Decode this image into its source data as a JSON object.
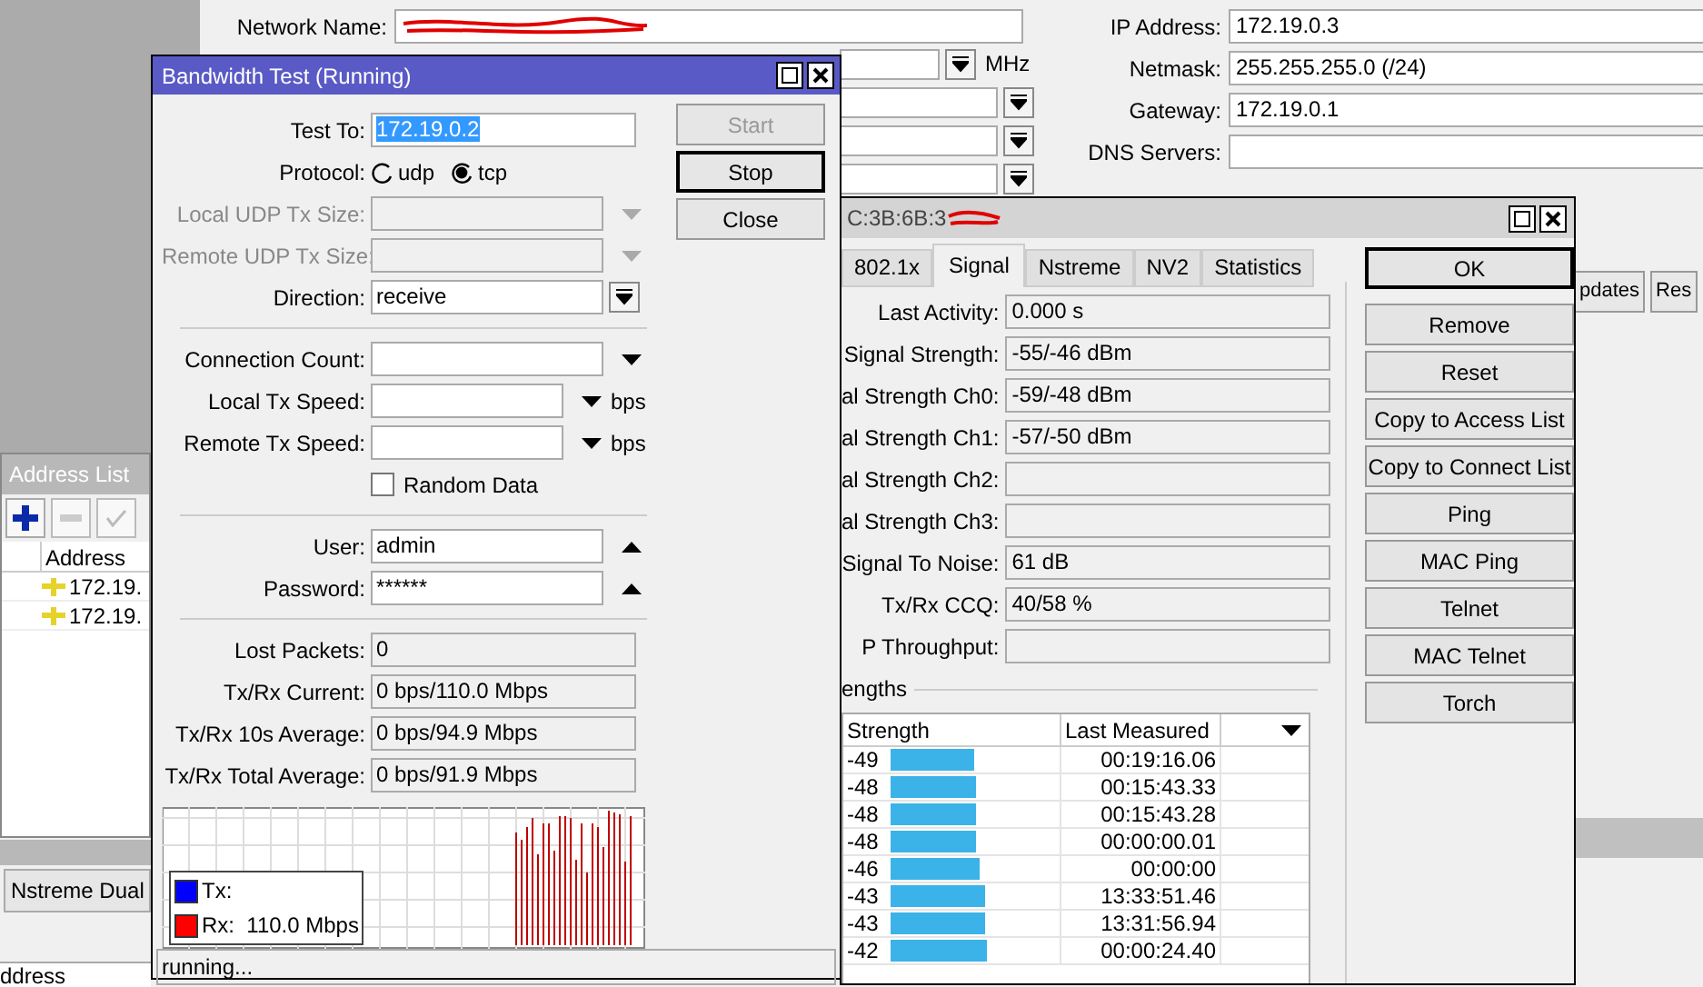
{
  "main_window": {
    "network_name": {
      "label": "Network Name:"
    },
    "frequency_unit": "MHz",
    "right_fields": [
      {
        "label": "IP Address:",
        "value": "172.19.0.3"
      },
      {
        "label": "Netmask:",
        "value": "255.255.255.0 (/24)"
      },
      {
        "label": "Gateway:",
        "value": "172.19.0.1"
      },
      {
        "label": "DNS Servers:"
      }
    ],
    "buttons": [
      "pdates",
      "Res"
    ]
  },
  "address_list": {
    "title": "Address List",
    "columns": [
      "Address"
    ],
    "rows": [
      "172.19.",
      "172.19."
    ]
  },
  "bottom_tab": "Nstreme Dual",
  "bottom_table": {
    "columns": [
      "ddress"
    ]
  },
  "bandwidth_test": {
    "title": "Bandwidth Test (Running)",
    "fields": [
      {
        "kind": "text",
        "label": "Test To:",
        "value": "172.19.0.2",
        "highlighted": true
      },
      {
        "kind": "radio",
        "label": "Protocol:",
        "options": [
          {
            "label": "udp",
            "selected": false
          },
          {
            "label": "tcp",
            "selected": true
          }
        ]
      },
      {
        "kind": "dropdown",
        "label": "Local UDP Tx Size:",
        "disabled": true
      },
      {
        "kind": "dropdown",
        "label": "Remote UDP Tx Size:",
        "disabled": true
      },
      {
        "kind": "select",
        "label": "Direction:",
        "value": "receive"
      },
      {
        "kind": "separator"
      },
      {
        "kind": "dropdown",
        "label": "Connection Count:",
        "disabled": false
      },
      {
        "kind": "dropdown",
        "label": "Local Tx Speed:",
        "disabled": false,
        "unit": "bps"
      },
      {
        "kind": "dropdown",
        "label": "Remote Tx Speed:",
        "disabled": false,
        "unit": "bps"
      },
      {
        "kind": "checkbox",
        "label": "Random Data",
        "checked": false
      },
      {
        "kind": "separator"
      },
      {
        "kind": "collapse",
        "label": "User:",
        "value": "admin"
      },
      {
        "kind": "collapse",
        "label": "Password:",
        "value": "******"
      },
      {
        "kind": "separator"
      },
      {
        "kind": "readonly",
        "label": "Lost Packets:",
        "value": "0"
      },
      {
        "kind": "readonly",
        "label": "Tx/Rx Current:",
        "value": "0 bps/110.0 Mbps"
      },
      {
        "kind": "readonly",
        "label": "Tx/Rx 10s Average:",
        "value": "0 bps/94.9 Mbps"
      },
      {
        "kind": "readonly",
        "label": "Tx/Rx Total Average:",
        "value": "0 bps/91.9 Mbps"
      }
    ],
    "buttons": [
      {
        "label": "Start",
        "disabled": true,
        "default": false
      },
      {
        "label": "Stop",
        "disabled": false,
        "default": true
      },
      {
        "label": "Close",
        "disabled": false,
        "default": false
      }
    ],
    "legend": [
      {
        "label": "Tx:",
        "color": "#0000ff"
      },
      {
        "label": "Rx:  110.0 Mbps",
        "color": "#ff0000"
      }
    ],
    "status": "running..."
  },
  "wireless_window": {
    "title": "C:3B:6B:3",
    "tabs": [
      {
        "label": "802.1x",
        "selected": false
      },
      {
        "label": "Signal",
        "selected": true
      },
      {
        "label": "Nstreme",
        "selected": false
      },
      {
        "label": "NV2",
        "selected": false
      },
      {
        "label": "Statistics",
        "selected": false
      }
    ],
    "fields": [
      {
        "label": "Last Activity:",
        "value": "0.000 s"
      },
      {
        "label": "Signal Strength:",
        "value": "-55/-46 dBm"
      },
      {
        "label": "al Strength Ch0:",
        "value": "-59/-48 dBm"
      },
      {
        "label": "al Strength Ch1:",
        "value": "-57/-50 dBm"
      },
      {
        "label": "al Strength Ch2:"
      },
      {
        "label": "al Strength Ch3:"
      },
      {
        "label": "Signal To Noise:",
        "value": "61 dB"
      },
      {
        "label": "Tx/Rx CCQ:",
        "value": "40/58 %"
      },
      {
        "label": "P Throughput:"
      }
    ],
    "group_label": "engths",
    "table": {
      "columns": [
        "Strength",
        "Last Measured"
      ],
      "rows": [
        {
          "strength": "-49",
          "level": 0.575,
          "last_measured": "00:19:16.06"
        },
        {
          "strength": "-48",
          "level": 0.59,
          "last_measured": "00:15:43.33"
        },
        {
          "strength": "-48",
          "level": 0.59,
          "last_measured": "00:15:43.28"
        },
        {
          "strength": "-48",
          "level": 0.59,
          "last_measured": "00:00:00.01"
        },
        {
          "strength": "-46",
          "level": 0.61,
          "last_measured": "00:00:00"
        },
        {
          "strength": "-43",
          "level": 0.65,
          "last_measured": "13:33:51.46"
        },
        {
          "strength": "-43",
          "level": 0.65,
          "last_measured": "13:31:56.94"
        },
        {
          "strength": "-42",
          "level": 0.66,
          "last_measured": "00:00:24.40"
        }
      ]
    },
    "buttons": [
      {
        "label": "OK",
        "default": true
      },
      {
        "label": "Remove",
        "default": false
      },
      {
        "label": "Reset",
        "default": false
      },
      {
        "label": "Copy to Access List",
        "default": false
      },
      {
        "label": "Copy to Connect List",
        "default": false
      },
      {
        "label": "Ping",
        "default": false
      },
      {
        "label": "MAC Ping",
        "default": false
      },
      {
        "label": "Telnet",
        "default": false
      },
      {
        "label": "MAC Telnet",
        "default": false
      },
      {
        "label": "Torch",
        "default": false
      }
    ]
  }
}
